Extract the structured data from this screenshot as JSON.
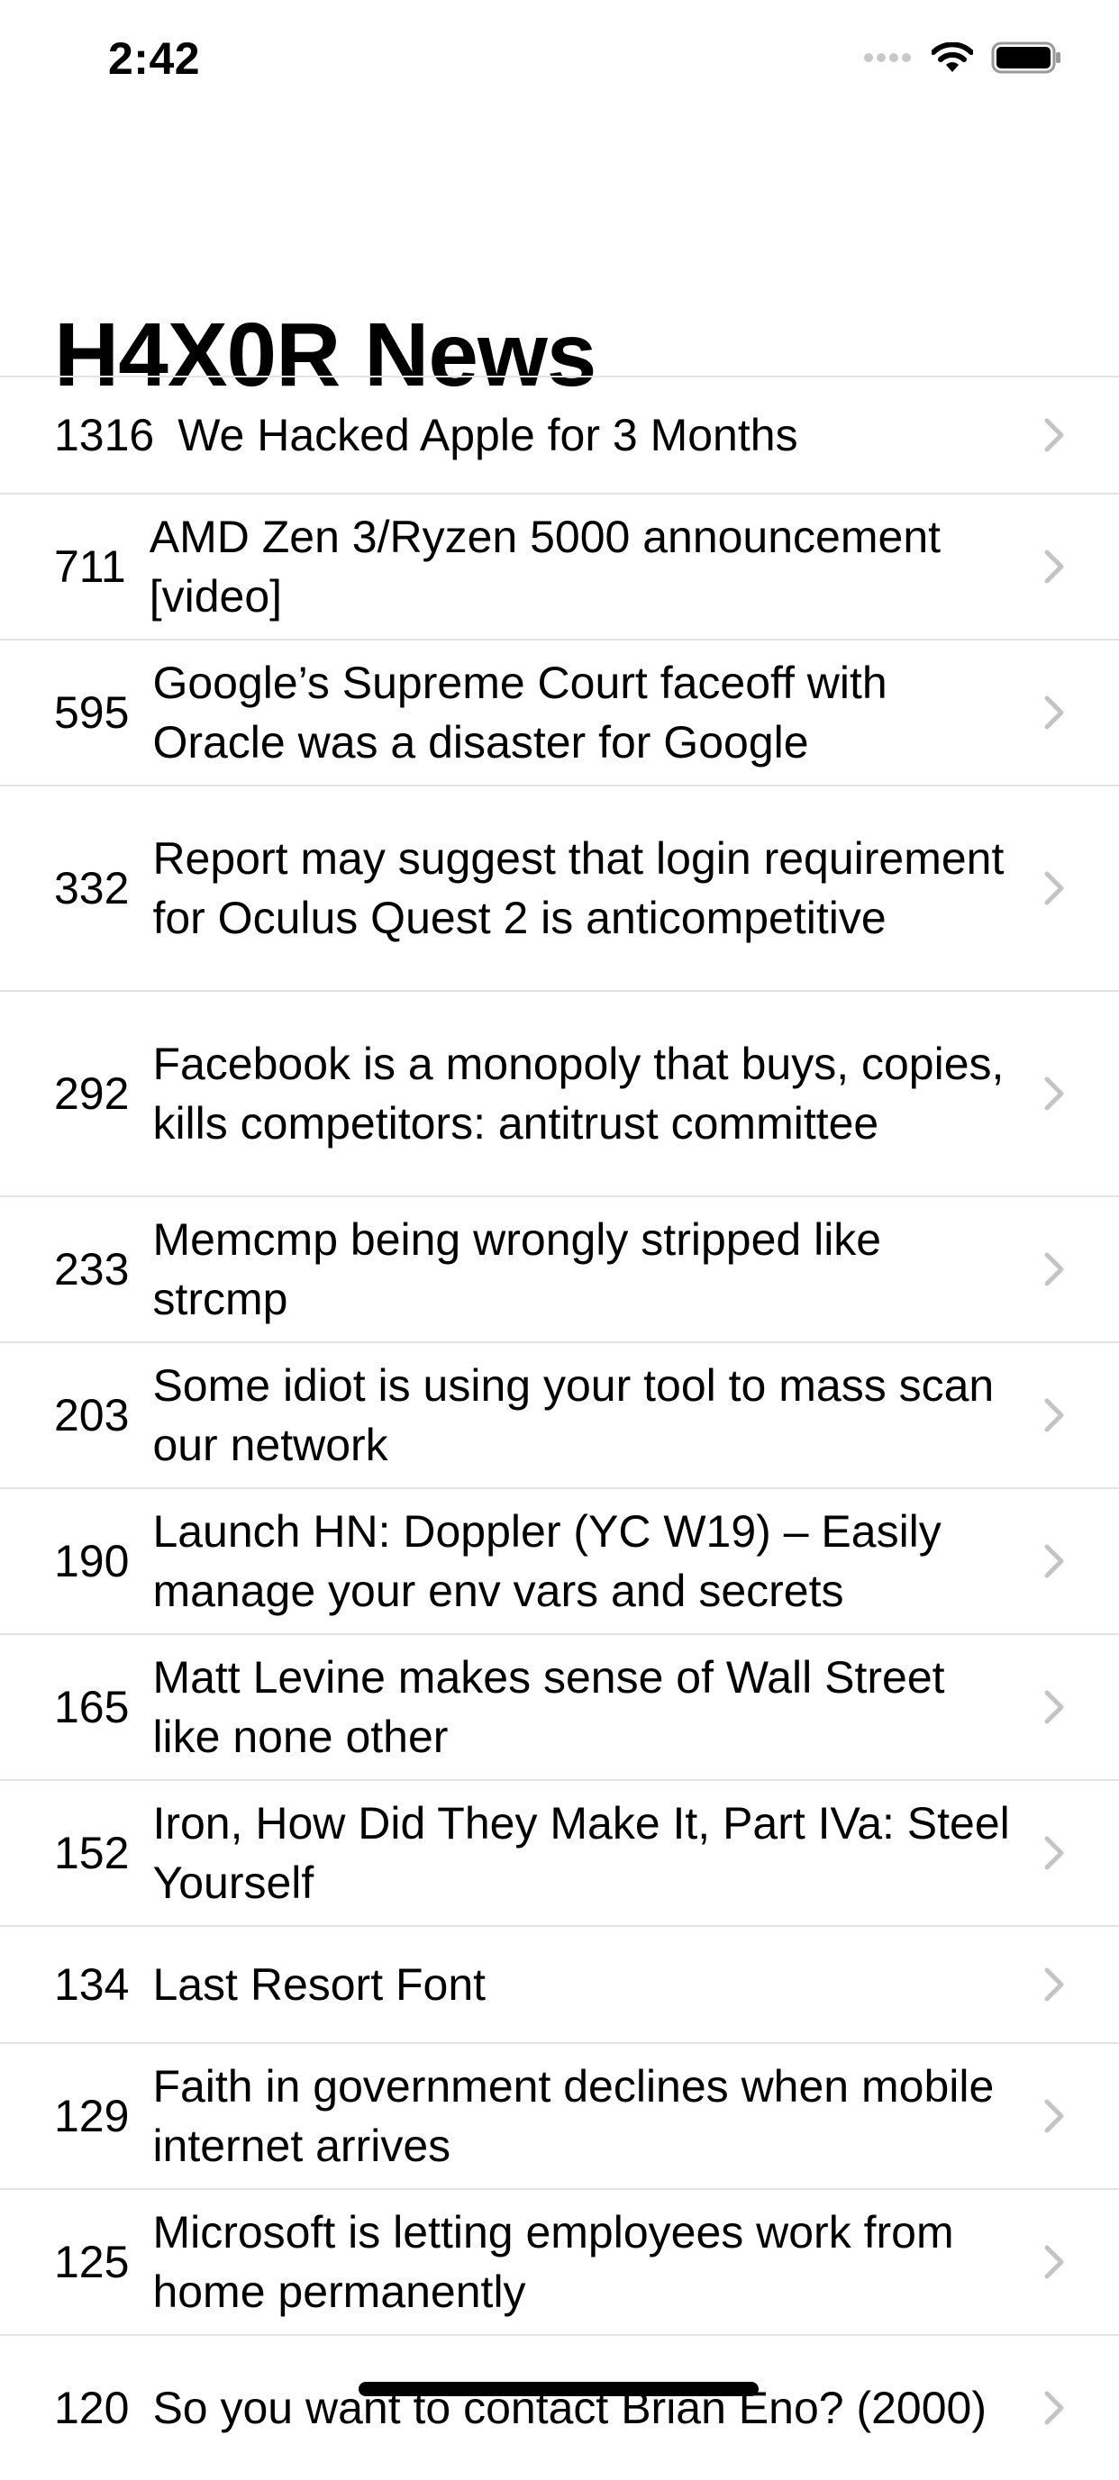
{
  "status_bar": {
    "time": "2:42",
    "icons": [
      "cellular-signal-icon",
      "wifi-icon",
      "battery-icon"
    ]
  },
  "nav": {
    "title": "H4X0R News"
  },
  "colors": {
    "separator": "#e3e3e6",
    "chevron": "#c4c4c7",
    "text": "#000000",
    "background": "#ffffff"
  },
  "stories": [
    {
      "points": "1316",
      "title": "We Hacked Apple for 3 Months"
    },
    {
      "points": "711",
      "title": "AMD Zen 3/Ryzen 5000 announcement [video]"
    },
    {
      "points": "595",
      "title": "Google’s Supreme Court faceoff with Oracle was a disaster for Google"
    },
    {
      "points": "332",
      "title": "Report may suggest that login requirement for Oculus Quest 2 is anticompetitive"
    },
    {
      "points": "292",
      "title": "Facebook is a monopoly that buys, copies, kills competitors: antitrust committee"
    },
    {
      "points": "233",
      "title": "Memcmp being wrongly stripped like strcmp"
    },
    {
      "points": "203",
      "title": "Some idiot is using your tool to mass scan our network"
    },
    {
      "points": "190",
      "title": "Launch HN: Doppler (YC W19) – Easily manage your env vars and secrets"
    },
    {
      "points": "165",
      "title": "Matt Levine makes sense of Wall Street like none other"
    },
    {
      "points": "152",
      "title": "Iron, How Did They Make It, Part IVa: Steel Yourself"
    },
    {
      "points": "134",
      "title": "Last Resort Font"
    },
    {
      "points": "129",
      "title": "Faith in government declines when mobile internet arrives"
    },
    {
      "points": "125",
      "title": "Microsoft is letting employees work from home permanently"
    },
    {
      "points": "120",
      "title": "So you want to contact Brian Eno? (2000)"
    }
  ]
}
